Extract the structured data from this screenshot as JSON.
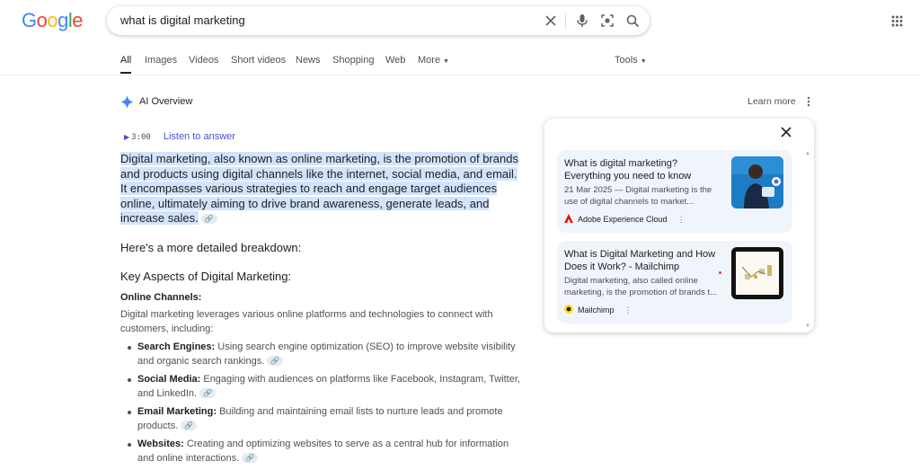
{
  "logo": {
    "letters": [
      "G",
      "o",
      "o",
      "g",
      "l",
      "e"
    ],
    "colors": [
      "#4285f4",
      "#ea4335",
      "#fbbc05",
      "#4285f4",
      "#34a853",
      "#ea4335"
    ]
  },
  "search": {
    "query": "what is digital marketing"
  },
  "icons": {
    "clear": "close-icon",
    "voice": "mic-icon",
    "lens": "camera-icon",
    "search": "search-icon",
    "apps": "apps-grid-icon"
  },
  "tabs": [
    "All",
    "Images",
    "Videos",
    "Short videos",
    "News",
    "Shopping",
    "Web",
    "More"
  ],
  "tools_label": "Tools",
  "ai_overview": {
    "title": "AI Overview",
    "learn_more": "Learn more",
    "listen_duration": "3:00",
    "listen_label": "Listen to answer",
    "intro_part1": "Digital marketing, also known as online marketing, is ",
    "intro_part2": "the promotion of brands and products using digital channels like the internet, social media, and email",
    "intro_part3": ". It encompasses various strategies to reach and engage target audiences online, ultimately aiming to drive brand awareness, generate leads, and increase sales.",
    "breakdown": "Here's a more detailed breakdown:",
    "key_aspects": "Key Aspects of Digital Marketing:",
    "online_channels_heading": "Online Channels:",
    "online_channels_desc": "Digital marketing leverages various online platforms and technologies to connect with customers, including:",
    "bullets": [
      {
        "term": "Search Engines:",
        "text": " Using search engine optimization (SEO) to improve website visibility and organic search rankings."
      },
      {
        "term": "Social Media:",
        "text": " Engaging with audiences on platforms like Facebook, Instagram, Twitter, and LinkedIn."
      },
      {
        "term": "Email Marketing:",
        "text": " Building and maintaining email lists to nurture leads and promote products."
      },
      {
        "term": "Websites:",
        "text": " Creating and optimizing websites to serve as a central hub for information and online interactions."
      }
    ]
  },
  "sources": [
    {
      "title": "What is digital marketing? Everything you need to know",
      "snippet": "21 Mar 2025 — Digital marketing is the use of digital channels to market...",
      "source": "Adobe Experience Cloud"
    },
    {
      "title": "What is Digital Marketing and How Does it Work? - Mailchimp",
      "snippet": "Digital marketing, also called online marketing, is the promotion of brands t...",
      "source": "Mailchimp"
    }
  ]
}
